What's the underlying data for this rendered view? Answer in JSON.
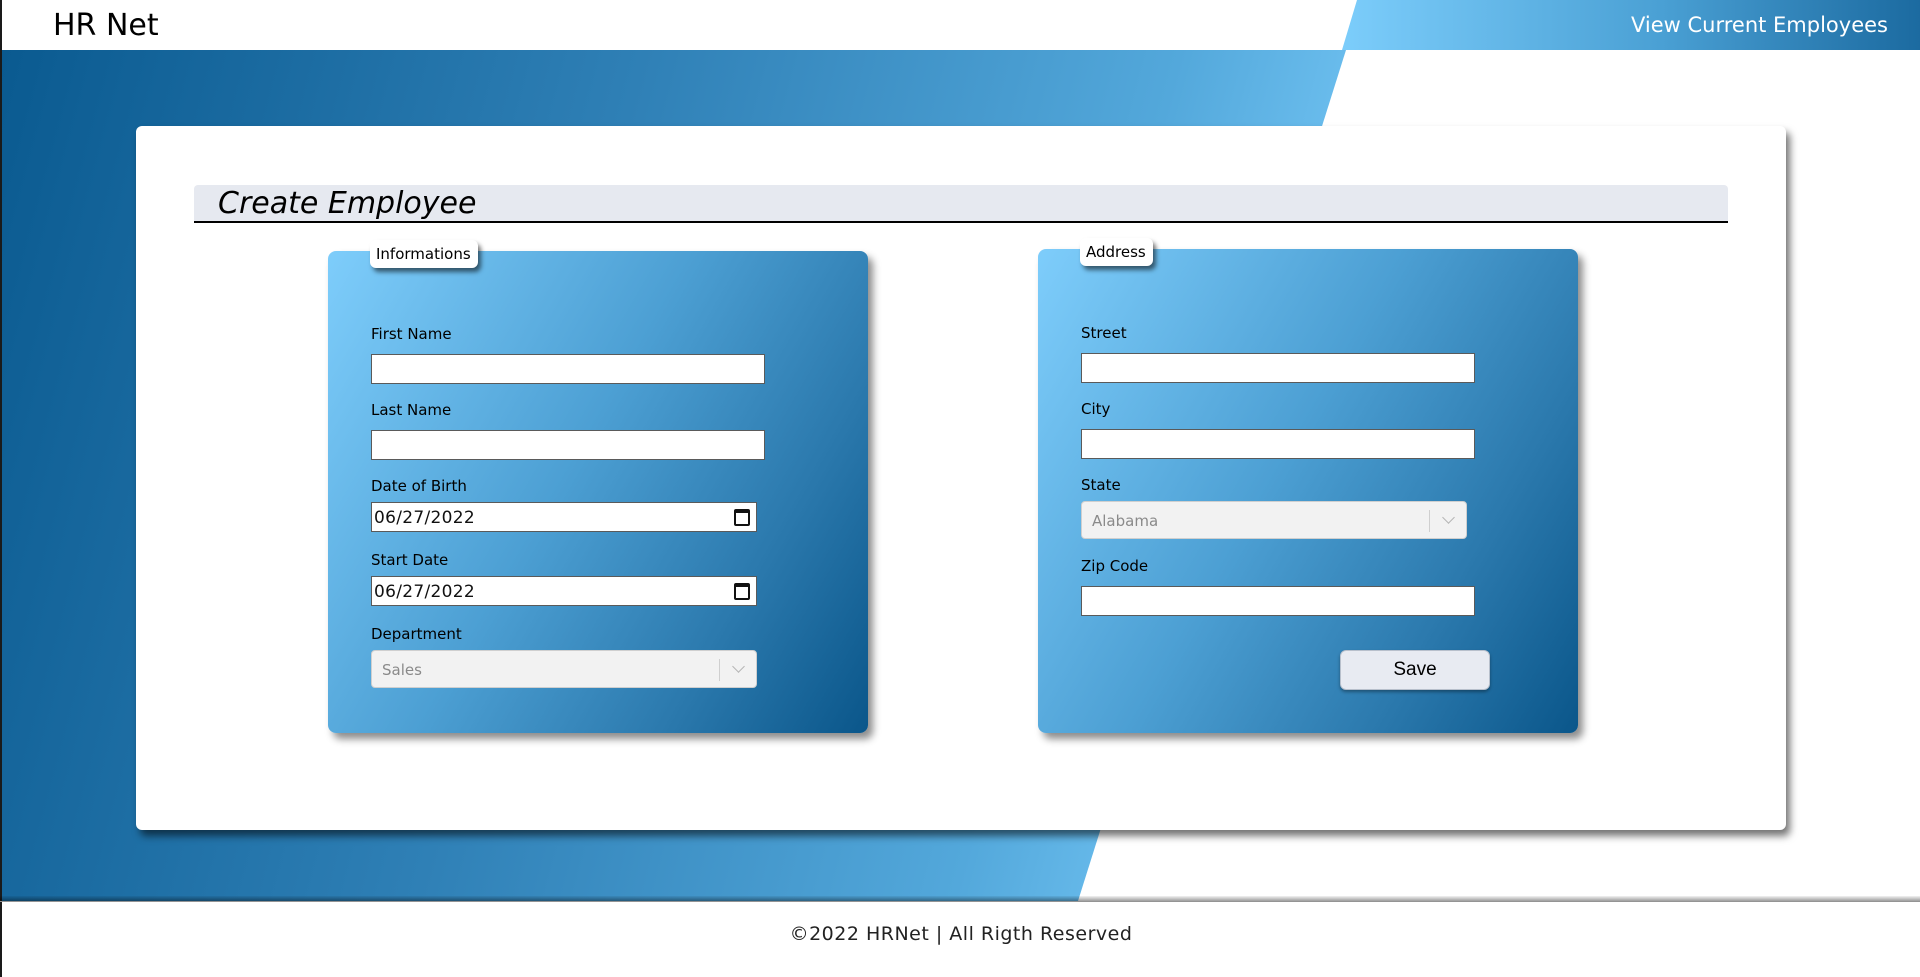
{
  "header": {
    "brand": "HR Net",
    "nav_link": "View Current Employees"
  },
  "main": {
    "title": "Create Employee",
    "informations": {
      "legend": "Informations",
      "first_name_label": "First Name",
      "first_name_value": "",
      "last_name_label": "Last Name",
      "last_name_value": "",
      "dob_label": "Date of Birth",
      "dob_value": "06/27/2022",
      "start_label": "Start Date",
      "start_value": "06/27/2022",
      "department_label": "Department",
      "department_value": "Sales"
    },
    "address": {
      "legend": "Address",
      "street_label": "Street",
      "street_value": "",
      "city_label": "City",
      "city_value": "",
      "state_label": "State",
      "state_value": "Alabama",
      "zip_label": "Zip Code",
      "zip_value": "",
      "save_label": "Save"
    }
  },
  "footer": {
    "text": "©2022 HRNet | All Rigth Reserved"
  },
  "colors": {
    "gradient_dark": "#0a568a",
    "gradient_light": "#7ecdfb",
    "title_bar": "#e6e9f0",
    "button": "#e8ebf2"
  },
  "icons": [
    "calendar-icon",
    "chevron-down-icon"
  ]
}
